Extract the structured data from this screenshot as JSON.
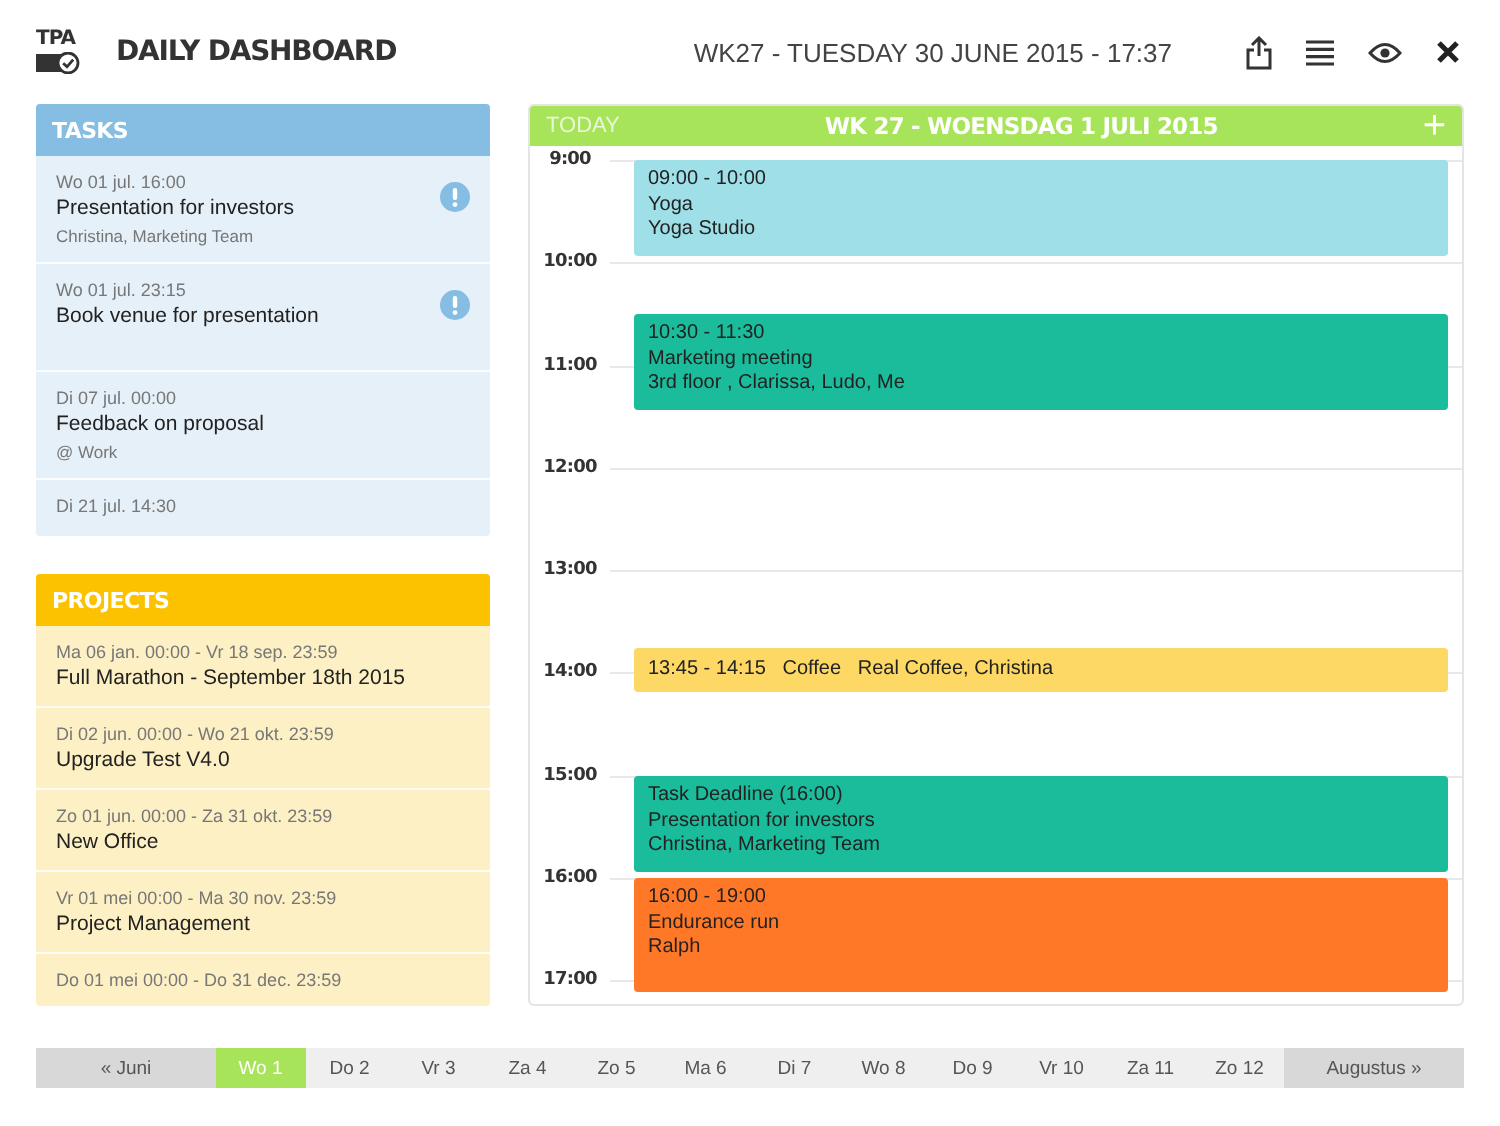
{
  "header": {
    "logo_text": "TPA",
    "title": "DAILY DASHBOARD",
    "datetime": "WK27 - TUESDAY 30 JUNE 2015 - 17:37"
  },
  "tasks": {
    "title": "TASKS",
    "items": [
      {
        "date": "Wo 01 jul. 16:00",
        "title": "Presentation for investors",
        "subtitle": "Christina, Marketing Team",
        "alert": true
      },
      {
        "date": "Wo 01 jul. 23:15",
        "title": "Book venue for presentation",
        "alert": true
      },
      {
        "date": "Di 07 jul. 00:00",
        "title": "Feedback on proposal",
        "subtitle": "@ Work",
        "alert": false
      },
      {
        "date": "Di 21 jul. 14:30",
        "alert": false
      }
    ]
  },
  "projects": {
    "title": "PROJECTS",
    "items": [
      {
        "dates": "Ma 06 jan. 00:00 - Vr 18 sep. 23:59",
        "title": "Full Marathon - September 18th 2015"
      },
      {
        "dates": "Di 02 jun. 00:00 - Wo 21 okt. 23:59",
        "title": "Upgrade Test V4.0"
      },
      {
        "dates": "Zo 01 jun. 00:00 - Za 31 okt. 23:59",
        "title": "New Office"
      },
      {
        "dates": "Vr 01 mei 00:00 - Ma 30 nov. 23:59",
        "title": "Project Management"
      },
      {
        "dates": "Do 01 mei 00:00 - Do 31 dec. 23:59"
      }
    ]
  },
  "calendar": {
    "today": "TODAY",
    "title": "WK 27 - WOENSDAG 1 JULI 2015",
    "add": "+",
    "hours": [
      "9:00",
      "10:00",
      "11:00",
      "12:00",
      "13:00",
      "14:00",
      "15:00",
      "16:00",
      "17:00"
    ],
    "events": [
      {
        "kind": "stacked",
        "color": "#9fdfe8",
        "lines": [
          "09:00 - 10:00",
          "Yoga",
          "Yoga Studio"
        ]
      },
      {
        "kind": "stacked",
        "color": "#1bbc9b",
        "lines": [
          "10:30 - 11:30",
          "Marketing meeting",
          "3rd floor , Clarissa, Ludo, Me"
        ]
      },
      {
        "kind": "inline",
        "color": "#fdd865",
        "lines": [
          "13:45 - 14:15",
          "Coffee",
          "Real Coffee, Christina"
        ]
      },
      {
        "kind": "stacked",
        "color": "#1bbc9b",
        "lines": [
          "Task Deadline (16:00)",
          "Presentation for investors",
          "Christina, Marketing Team"
        ]
      },
      {
        "kind": "stacked",
        "color": "#ff7828",
        "lines": [
          "16:00 - 19:00",
          "Endurance run",
          "Ralph"
        ]
      }
    ]
  },
  "day_bar": {
    "previous": "« Juni",
    "next": "Augustus »",
    "days": [
      {
        "label": "Wo 1",
        "selected": true
      },
      {
        "label": "Do 2",
        "selected": false
      },
      {
        "label": "Vr 3",
        "selected": false
      },
      {
        "label": "Za 4",
        "selected": false
      },
      {
        "label": "Zo 5",
        "selected": false
      },
      {
        "label": "Ma 6",
        "selected": false
      },
      {
        "label": "Di 7",
        "selected": false
      },
      {
        "label": "Wo 8",
        "selected": false
      },
      {
        "label": "Do 9",
        "selected": false
      },
      {
        "label": "Vr 10",
        "selected": false
      },
      {
        "label": "Za 11",
        "selected": false
      },
      {
        "label": "Zo 12",
        "selected": false
      }
    ]
  }
}
